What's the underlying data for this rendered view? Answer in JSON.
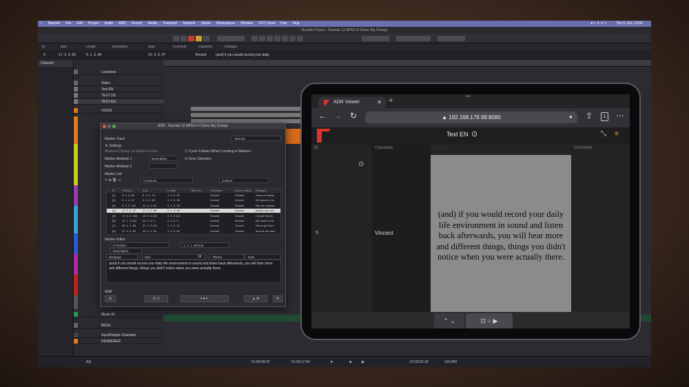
{
  "menubar": {
    "items": [
      "Nuendo",
      "File",
      "Edit",
      "Project",
      "Audio",
      "MIDI",
      "Scores",
      "Media",
      "Transport",
      "Network",
      "Studio",
      "Workspaces",
      "Window",
      "VST Cloud",
      "Hub",
      "Help"
    ],
    "clock": "Thu 5. Oct. 13:55"
  },
  "daw": {
    "window_title": "Nuendo Project - Nuendo 13 MPE0-H Demo Big Orange",
    "infoline_labels": [
      "ID",
      "Start",
      "Length",
      "Description",
      "Start",
      "Comment",
      "Character",
      "Dialogue"
    ],
    "infoline_values": {
      "id": "5",
      "start": "17. 3. 3. 50",
      "length": "5. 1. 3. 45",
      "start2": "31. 3. 3. 47",
      "character": "Vincent",
      "dialogue": "(and) if you would record your daily"
    },
    "inspector_title": "Channel",
    "tracks": [
      "Loudness",
      "Video",
      "Text EN",
      "TEXT DE",
      "TEXT ES",
      "VOICE",
      "Music 01",
      "BEDS",
      "Input/Output Channels",
      "RENDERER"
    ],
    "transport": {
      "pos1": "01:00:09:22",
      "pos2": "01:00:17:04",
      "pos3": "01:00:22:18",
      "tempo": "120.000",
      "left_label": "AQ"
    }
  },
  "adr": {
    "title": "ADR - Nuendo 13 MPEG-H Demo Big Orange",
    "marker_track_label": "Marker Track",
    "marker_track_value": "Text EN",
    "settings_label": "Settings",
    "attr_display_label": "Attribute Display on Marker Events",
    "attr1_label": "Marker Attribute 1",
    "attr1_value": "Description",
    "attr2_label": "Marker Attribute 2",
    "cycle_label": "Cycle Follows When Locating to Markers",
    "sync_label": "Sync Selection",
    "marker_list_label": "Marker List",
    "functions_label": "Functions",
    "column_label": "Column",
    "table_headers": [
      "ID",
      "Position",
      "End",
      "Length",
      "Take No.",
      "Character",
      "Actor's Name",
      "Dialogue"
    ],
    "rows": [
      {
        "id": "[1]",
        "pos": "3. 4. 3. 63",
        "end": "5. 4. 2. 73",
        "len": "1. 3. 3. 90",
        "take": "",
        "char": "Vincent",
        "actor": "Vincent",
        "dlg": "Sound is alway"
      },
      {
        "id": "[2]",
        "pos": "5. 4. 4. 22",
        "end": "9. 3. 2. 80",
        "len": "3. 3. 2. 38",
        "take": "",
        "char": "Vincent",
        "actor": "Vincent",
        "dlg": "We ignore a lot"
      },
      {
        "id": "[3]",
        "pos": "9. 3. 4. 109",
        "end": "11. 4. 4. 64",
        "len": "2. 1. 3. 35",
        "take": "",
        "char": "Vincent",
        "actor": "Vincent",
        "dlg": "We can choose"
      },
      {
        "id": "[4]",
        "pos": "12. 2. 3. 47",
        "end": "17. 3. 2. 60",
        "len": "5. 1. 3. 45",
        "take": "",
        "char": "Vincent",
        "actor": "Vincent",
        "dlg": "(and) if you wo"
      },
      {
        "id": "[5]",
        "pos": "17. 3. 4. 109",
        "end": "19. 4. 4.100",
        "len": "2. 0. 2.112",
        "take": "",
        "char": "Vincent",
        "actor": "Vincent",
        "dlg": "I found that lis"
      },
      {
        "id": "[6]",
        "pos": "21. 1. 3.118",
        "end": "24. 4. 4. 2",
        "len": "3. 3. 4. 3",
        "take": "",
        "char": "Vincent",
        "actor": "Vincent",
        "dlg": "My name is Vin"
      },
      {
        "id": "[7]",
        "pos": "25. 1. 1. 88",
        "end": "27. 3. 3.110",
        "len": "2. 2. 2. 21",
        "take": "",
        "char": "Vincent",
        "actor": "Vincent",
        "dlg": "We've got five f"
      },
      {
        "id": "[8]",
        "pos": "27. 3. 3. 93",
        "end": "30. 3. 3. 63",
        "len": "3. 0. 0. 89",
        "take": "",
        "char": "Vincent",
        "actor": "Vincent",
        "dlg": "and we are also"
      }
    ],
    "marker_editor_label": "Marker Editor",
    "position_value": "5 Position",
    "range_value": "1. 1. 1. 20 End",
    "description_label": "Description",
    "dialogue_label": "Dialogue",
    "size_label": "Size",
    "size_value": "16",
    "theme_label": "Theme",
    "theme_value": "Dark",
    "dialogue_text": "(and) if you would record your daily life environment in sound and listen back afterwards, you will hear more and different things, things you didn't notice when you were actually there.",
    "adr_section_label": "ADR"
  },
  "browser": {
    "tab_title": "ADR Viewer",
    "url": "192.168.178.99:8080",
    "tab_count": "1",
    "app_title": "Text EN",
    "col_id": "ID",
    "col_character": "Character",
    "col_dialogue": "Dialogue",
    "col_comment": "Comment",
    "row_id": "5",
    "row_character": "Vincent",
    "row_dialogue": "(and) if you would record your daily life environment in sound and listen back afterwards, you will hear more and different things, things you didn't notice when you were actually there.",
    "colors": {
      "brand": "#d9352b",
      "card": "#8b8b8d"
    }
  }
}
